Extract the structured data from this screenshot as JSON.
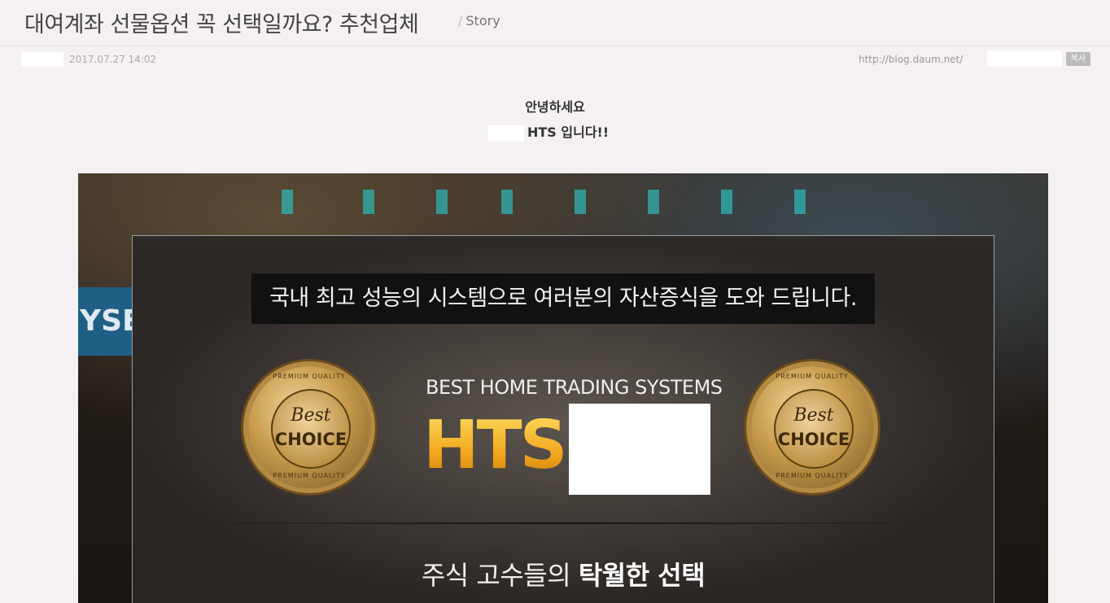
{
  "post": {
    "title": "대여계좌 선물옵션 꼭 선택일까요? 추천업체",
    "category_prefix": "/",
    "category": "Story",
    "date": "2017.07.27 14:02",
    "url": "http://blog.daum.net/",
    "copy_label": "복사"
  },
  "content": {
    "greeting_line1": "안녕하세요",
    "greeting_line2": "HTS 입니다!!"
  },
  "banner": {
    "nyse_text": "YSE",
    "slogan": "국내 최고 성능의 시스템으로 여러분의 자산증식을 도와 드립니다.",
    "badge_best": "Best",
    "badge_choice": "CHOICE",
    "badge_ring_top": "PREMIUM QUALITY",
    "badge_ring_bottom": "PREMIUM QUALITY",
    "subtitle": "BEST HOME TRADING SYSTEMS",
    "logo_text": "HTS",
    "tagline_prefix": "주식 고수들의 ",
    "tagline_bold": "탁월한 선택"
  },
  "colors": {
    "page_bg": "#f5f1f2",
    "hts_gold": "#e8a51a",
    "slogan_bg": "#111111"
  }
}
